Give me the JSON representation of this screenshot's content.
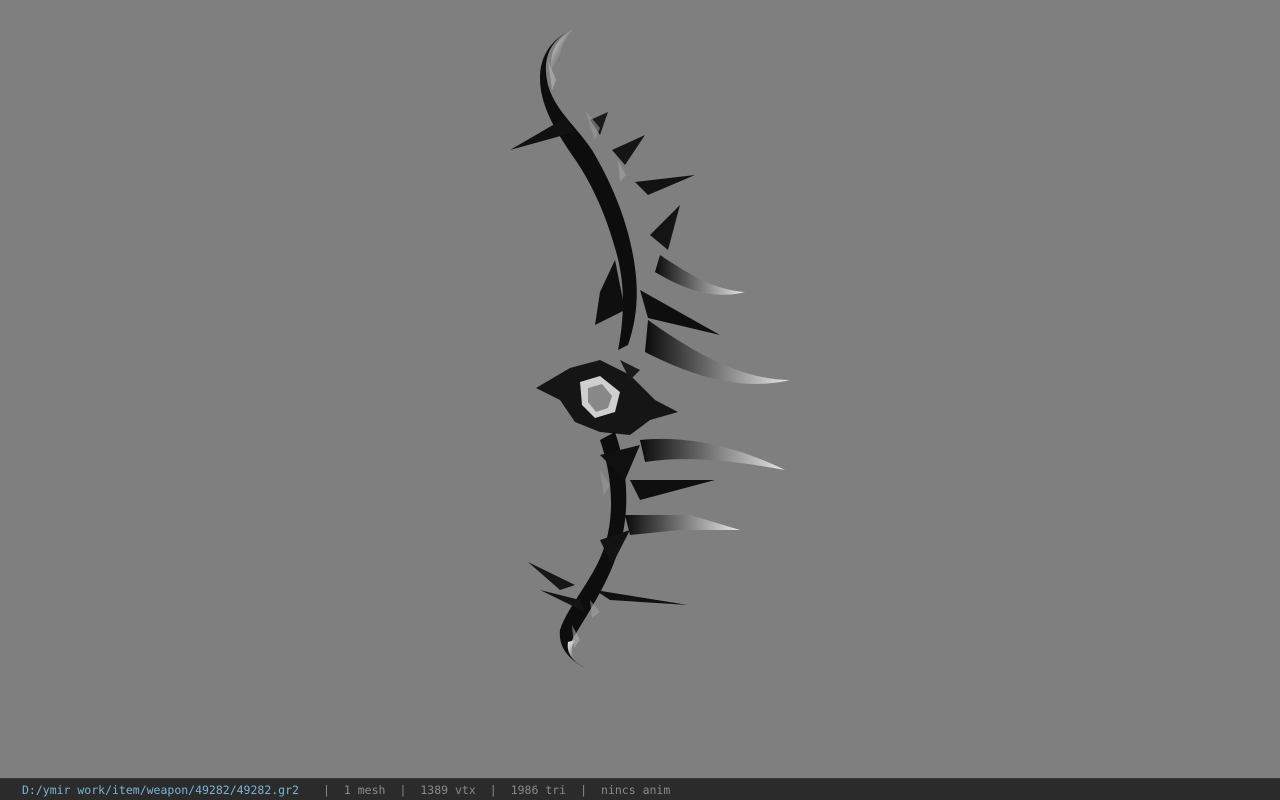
{
  "viewport": {
    "background": "#7f7f7f",
    "model": "bow-icon"
  },
  "status_bar": {
    "path": "D:/ymir work/item/weapon/49282/49282.gr2",
    "separator": "|",
    "mesh": "1 mesh",
    "vertices": "1389 vtx",
    "triangles": "1986 tri",
    "animation": "nincs anim",
    "path_color": "#78b4d6",
    "text_color": "#8a8a8a"
  }
}
